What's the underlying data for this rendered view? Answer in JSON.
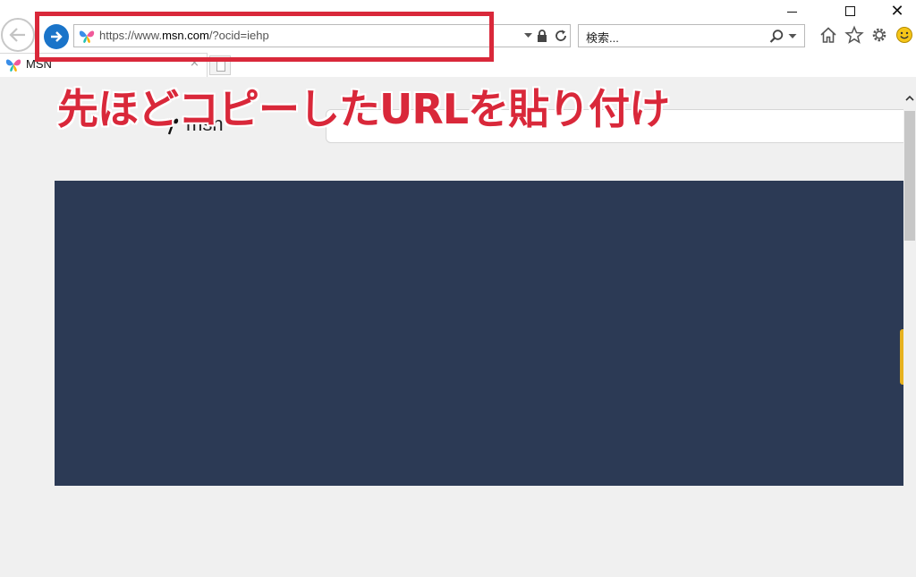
{
  "browser": {
    "address_bar": {
      "url_prefix": "https://www.",
      "url_host": "msn.com",
      "url_path": "/?ocid=iehp"
    },
    "search_box": {
      "placeholder": "検索..."
    },
    "tab": {
      "title": "MSN",
      "close_glyph": "×"
    },
    "window_controls": {
      "close_glyph": "✕"
    },
    "toolbar_icons": [
      "home-icon",
      "favorites-icon",
      "settings-icon",
      "feedback-icon"
    ]
  },
  "page": {
    "logo_text": "msn",
    "hero_color": "#2c3a55"
  },
  "annotation": {
    "text": "先ほどコピーしたURLを貼り付け",
    "color": "#d9283a"
  }
}
